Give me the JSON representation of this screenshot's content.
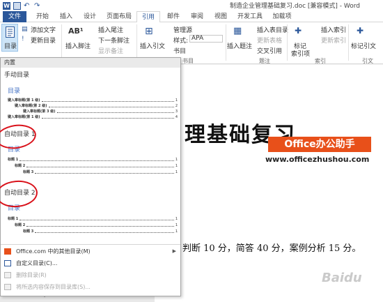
{
  "window": {
    "title": "制造企业管理基础复习.doc [兼容模式] - Word"
  },
  "tabs": [
    {
      "label": "文件"
    },
    {
      "label": "开始"
    },
    {
      "label": "插入"
    },
    {
      "label": "设计"
    },
    {
      "label": "页面布局"
    },
    {
      "label": "引用"
    },
    {
      "label": "邮件"
    },
    {
      "label": "审阅"
    },
    {
      "label": "视图"
    },
    {
      "label": "开发工具"
    },
    {
      "label": "加载项"
    }
  ],
  "ribbon": {
    "toc": {
      "label": "目录",
      "add_text": "添加文字",
      "update_toc": "更新目录"
    },
    "footnotes": {
      "insert_footnote": "插入脚注",
      "insert_endnote": "插入尾注",
      "next_footnote": "下一条脚注",
      "show_notes": "显示备注"
    },
    "citations": {
      "insert_citation": "插入引文",
      "manage_sources": "管理源",
      "style_label": "样式:",
      "style_value": "APA",
      "bibliography": "书目"
    },
    "captions": {
      "insert_caption": "插入题注",
      "insert_table_of_figures": "插入表目录",
      "update_table": "更新表格",
      "cross_reference": "交叉引用",
      "group_label": "题注"
    },
    "index": {
      "mark_entry": "标记",
      "mark_entry2": "索引项",
      "insert_index": "插入索引",
      "update_index": "更新索引",
      "group_label": "索引"
    },
    "authorities": {
      "mark_citation": "标记引文",
      "group_label": "引文"
    },
    "citations_group_label": "书目"
  },
  "dropdown": {
    "header": "内置",
    "manual": {
      "label": "手动目录",
      "preview_title": "目录",
      "rows": [
        {
          "label": "键入章标题(第 1 级)",
          "page": "1"
        },
        {
          "label": "键入章标题(第 2 级)",
          "page": "2"
        },
        {
          "label": "键入章标题(第 3 级)",
          "page": "3"
        },
        {
          "label": "键入章标题(第 1 级)",
          "page": "4"
        }
      ]
    },
    "auto1": {
      "label": "自动目录 1",
      "preview_title": "目录",
      "rows": [
        {
          "label": "标题 1",
          "page": "1"
        },
        {
          "label": "标题 2",
          "page": "1"
        },
        {
          "label": "标题 3",
          "page": "1"
        }
      ]
    },
    "auto2": {
      "label": "自动目录 2",
      "preview_title": "目录",
      "rows": [
        {
          "label": "标题 1",
          "page": "1"
        },
        {
          "label": "标题 2",
          "page": "1"
        },
        {
          "label": "标题 3",
          "page": "1"
        }
      ]
    },
    "menu": [
      {
        "label": "Office.com 中的其他目录(M)",
        "disabled": false
      },
      {
        "label": "自定义目录(C)...",
        "disabled": false
      },
      {
        "label": "删除目录(R)",
        "disabled": true
      },
      {
        "label": "将所选内容保存到目录库(S)...",
        "disabled": true
      }
    ]
  },
  "document": {
    "title_fragment": "理基础复习",
    "body_fragment": "判断 10 分，简答 40 分，案例分析 15 分。"
  },
  "watermark": {
    "brand": "Office办公助手",
    "url": "www.officezhushou.com",
    "baidu": "Baidu"
  },
  "colors": {
    "word_blue": "#2b579a",
    "annotation_red": "#d9111a",
    "watermark_orange": "#e8501a",
    "toc_title_blue": "#4472c4"
  }
}
